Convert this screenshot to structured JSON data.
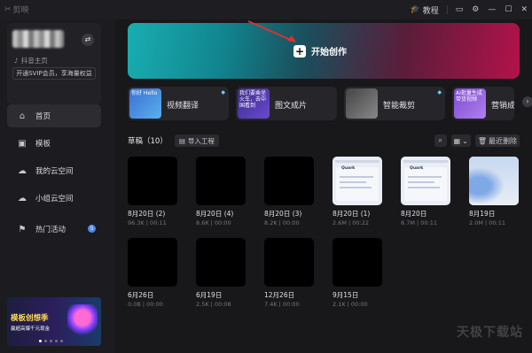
{
  "app": {
    "logo_text": "剪映"
  },
  "titlebar": {
    "tutorial": "教程"
  },
  "profile": {
    "douyin_home": "抖音主页",
    "svip_promo": "开通SVIP会员，享海量权益"
  },
  "nav": [
    {
      "label": "首页",
      "icon": "home-icon"
    },
    {
      "label": "模板",
      "icon": "template-icon"
    },
    {
      "label": "我的云空间",
      "icon": "cloud-icon"
    },
    {
      "label": "小组云空间",
      "icon": "group-cloud-icon"
    },
    {
      "label": "热门活动",
      "icon": "flag-icon",
      "badge": "5"
    }
  ],
  "banner": {
    "title": "模板创想季",
    "subtitle": "赢超高爆千元现金"
  },
  "hero": {
    "start_label": "开始创作"
  },
  "tools": [
    {
      "name": "视频翻译",
      "thumb_text": "你好 Hello",
      "premium": true
    },
    {
      "name": "图文成片",
      "thumb_text": "我们要乘坐火车，去中国看到",
      "premium": false
    },
    {
      "name": "智能裁剪",
      "thumb_text": "",
      "premium": true
    },
    {
      "name": "营销成片",
      "thumb_text": "AI批量生成带货视频",
      "premium": false
    }
  ],
  "drafts": {
    "title": "草稿（10）",
    "import_label": "导入工程",
    "delete_label": "最近删除",
    "items": [
      {
        "title": "8月20日 (2)",
        "meta": "96.3K | 00:11",
        "thumb": "black"
      },
      {
        "title": "8月20日 (4)",
        "meta": "8.6K | 00:00",
        "thumb": "black"
      },
      {
        "title": "8月20日 (3)",
        "meta": "8.2K | 00:00",
        "thumb": "black"
      },
      {
        "title": "8月20日 (1)",
        "meta": "2.6M | 00:22",
        "thumb": "doc",
        "doc_label": "Quark"
      },
      {
        "title": "8月20日",
        "meta": "8.7M | 00:11",
        "thumb": "doc",
        "doc_label": "Quark"
      },
      {
        "title": "8月19日",
        "meta": "2.0M | 00:11",
        "thumb": "wave"
      },
      {
        "title": "6月26日",
        "meta": "0.0B | 00:00",
        "thumb": "black"
      },
      {
        "title": "6月19日",
        "meta": "2.5K | 00:08",
        "thumb": "black"
      },
      {
        "title": "12月26日",
        "meta": "7.4K | 00:00",
        "thumb": "black"
      },
      {
        "title": "9月15日",
        "meta": "2.1K | 00:00",
        "thumb": "black"
      }
    ]
  },
  "watermark": "天极下载站"
}
